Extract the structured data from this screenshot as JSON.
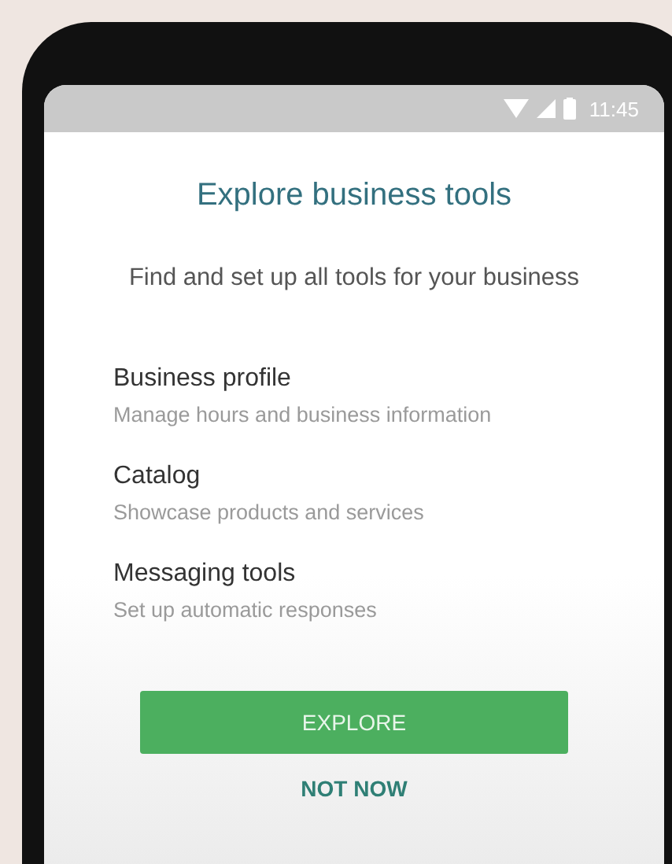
{
  "status_bar": {
    "time": "11:45"
  },
  "title": "Explore business tools",
  "subtitle": "Find and set up all tools for your business",
  "tools": [
    {
      "name": "Business profile",
      "description": "Manage hours and business information"
    },
    {
      "name": "Catalog",
      "description": "Showcase products and services"
    },
    {
      "name": "Messaging tools",
      "description": "Set up automatic responses"
    }
  ],
  "buttons": [
    {
      "label": "EXPLORE",
      "kind": "primary"
    },
    {
      "label": "NOT NOW",
      "kind": "text"
    }
  ]
}
